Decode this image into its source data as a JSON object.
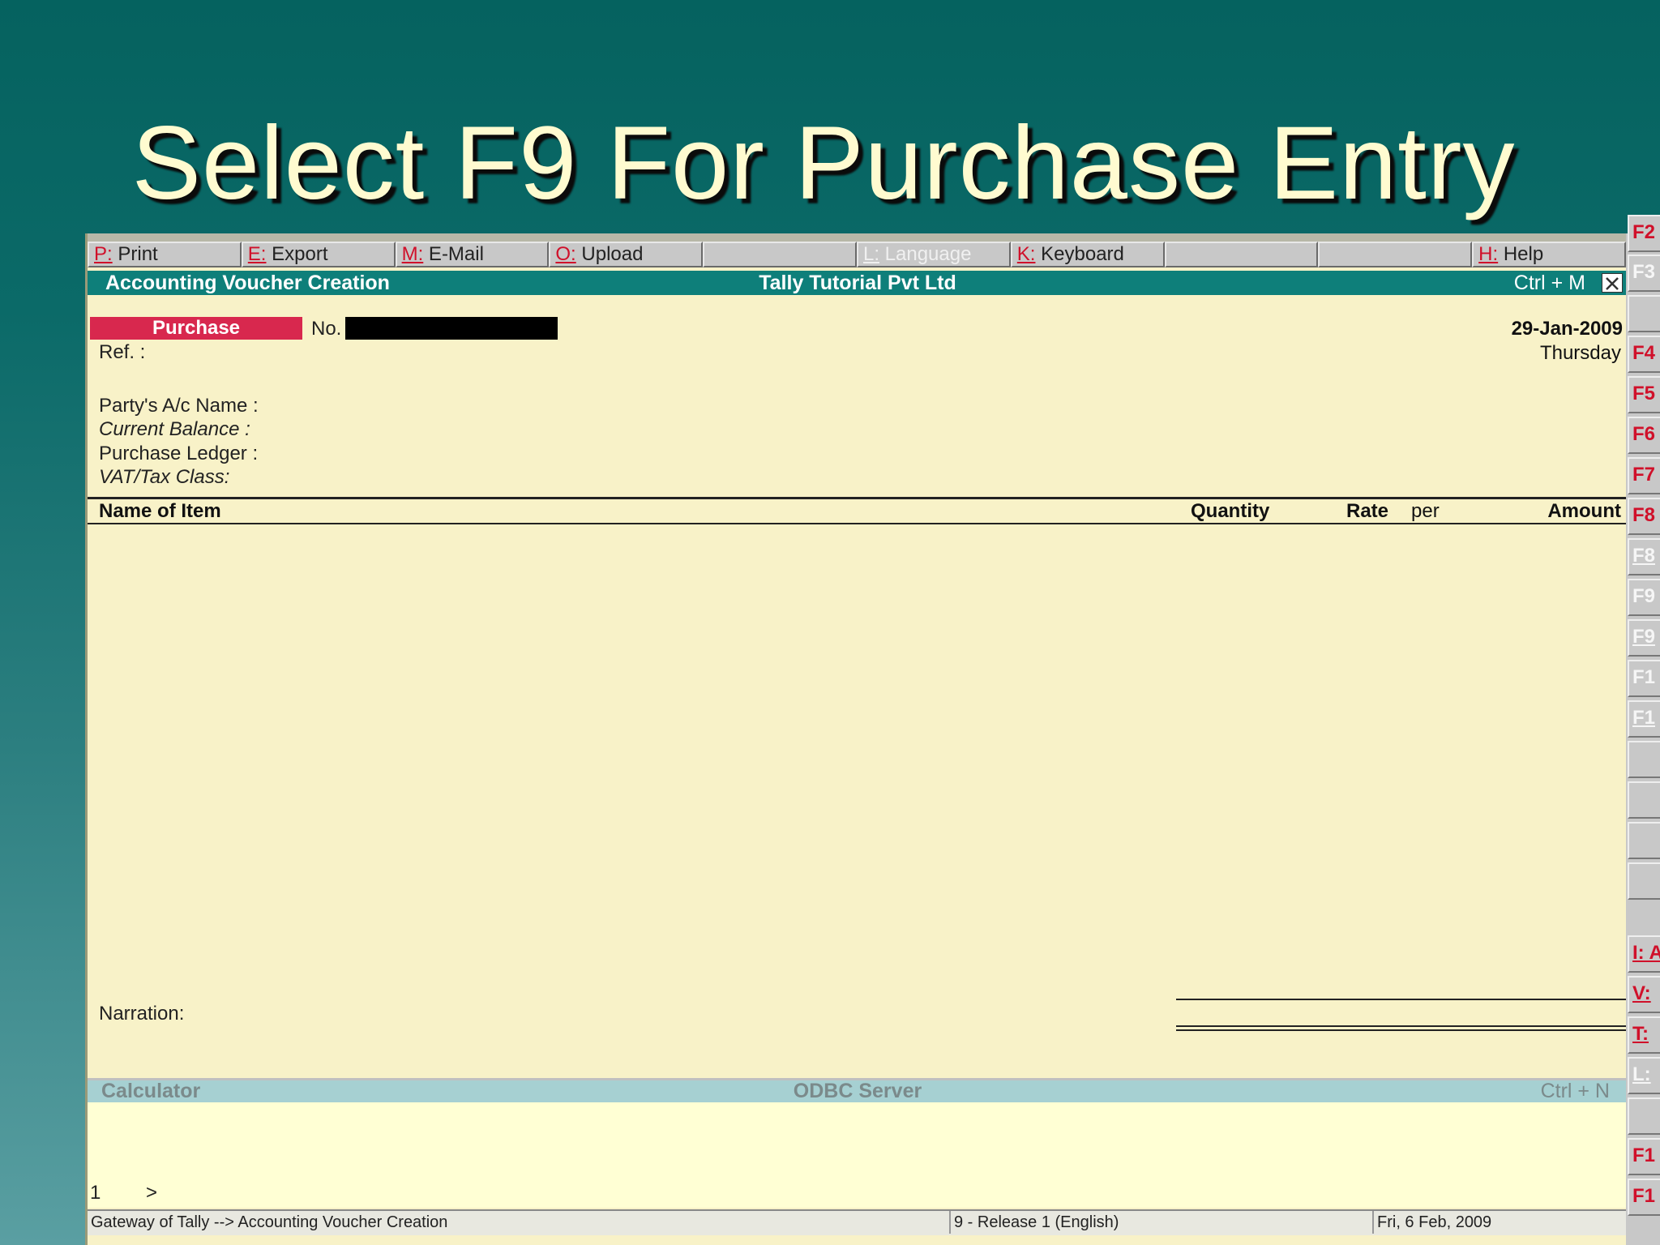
{
  "slide_title": "Select F9 For Purchase Entry",
  "toolbar": [
    {
      "key": "P:",
      "label": " Print",
      "dim": false
    },
    {
      "key": "E:",
      "label": " Export",
      "dim": false
    },
    {
      "key": "M:",
      "label": " E-Mail",
      "dim": false
    },
    {
      "key": "O:",
      "label": " Upload",
      "dim": false
    },
    {
      "key": "",
      "label": "",
      "dim": false
    },
    {
      "key": "L:",
      "label": " Language",
      "dim": true
    },
    {
      "key": "K:",
      "label": " Keyboard",
      "dim": false
    },
    {
      "key": "",
      "label": "",
      "dim": false
    },
    {
      "key": "",
      "label": "",
      "dim": false
    },
    {
      "key": "H:",
      "label": " Help",
      "dim": false
    }
  ],
  "header": {
    "title": "Accounting Voucher  Creation",
    "company": "Tally Tutorial Pvt Ltd",
    "shortcut": "Ctrl + M"
  },
  "voucher": {
    "type": "Purchase",
    "no_label": "No.",
    "ref_label": "Ref. :",
    "date": "29-Jan-2009",
    "day": "Thursday",
    "party_label": "Party's A/c Name :",
    "balance_label": "Current Balance :",
    "ledger_label": "Purchase Ledger :",
    "vat_label": "VAT/Tax Class:"
  },
  "columns": {
    "name": "Name of Item",
    "quantity": "Quantity",
    "rate": "Rate",
    "per": "per",
    "amount": "Amount"
  },
  "narration_label": "Narration:",
  "calculator": {
    "title": "Calculator",
    "server": "ODBC Server",
    "shortcut": "Ctrl + N",
    "line_no": "1",
    "prompt": ">"
  },
  "status": {
    "path": "Gateway of Tally --> Accounting Voucher  Creation",
    "release": "9 - Release 1 (English)",
    "date": "Fri, 6 Feb, 2009"
  },
  "side_keys": [
    "F2",
    "F3",
    "",
    "F4",
    "F5",
    "F6",
    "F7",
    "F8",
    "F8",
    "F9",
    "F9",
    "F1",
    "F1",
    "",
    "",
    "",
    "",
    "I: A",
    "V:",
    "T:",
    "L:",
    "",
    "F1",
    "F1"
  ],
  "colors": {
    "background_top": "#05625f",
    "panel": "#f8f2c8",
    "header_bar": "#0e7f7a",
    "voucher_type": "#d8284e",
    "calc_bar": "#a6d0d2",
    "hotkey": "#d0102a",
    "title_text": "#fffbd0"
  }
}
